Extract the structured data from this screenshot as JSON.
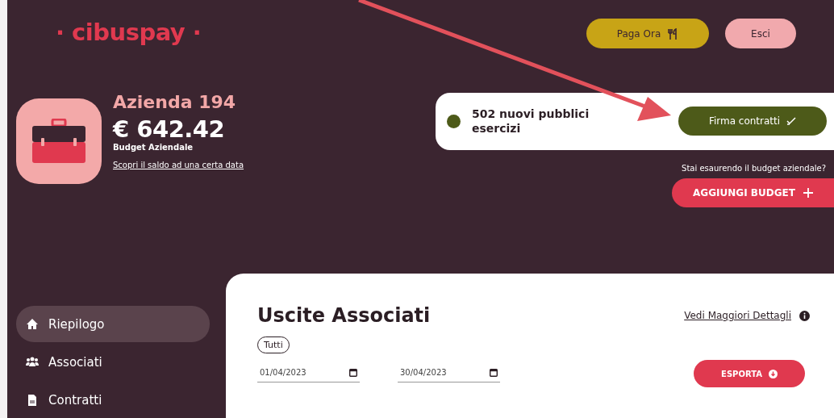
{
  "logo": {
    "text": "· cibuspay ·"
  },
  "header_buttons": [
    {
      "label": "Paga Ora",
      "kind": "pay"
    },
    {
      "label": "Esci",
      "kind": "logout"
    }
  ],
  "company": {
    "name": "Azienda 194",
    "balance": "€ 642.42",
    "balance_label": "Budget Aziendale",
    "link": "Scopri il saldo ad una certa data"
  },
  "notice": {
    "text": "502 nuovi pubblici esercizi",
    "button": "Firma contratti"
  },
  "budget_hint": "Stai esaurendo il budget aziendale?",
  "add_budget_button": "AGGIUNGI BUDGET",
  "sidebar": {
    "items": [
      {
        "label": "Riepilogo",
        "kind": "home",
        "selected": true
      },
      {
        "label": "Associati",
        "kind": "users",
        "selected": false
      },
      {
        "label": "Contratti",
        "kind": "document",
        "selected": false
      }
    ]
  },
  "panel": {
    "title": "Uscite Associati",
    "details_link": "Vedi Maggiori Dettagli",
    "filter_chip": "Tutti",
    "date_from": "01/04/2023",
    "date_to": "30/04/2023",
    "export_button": "ESPORTA"
  }
}
